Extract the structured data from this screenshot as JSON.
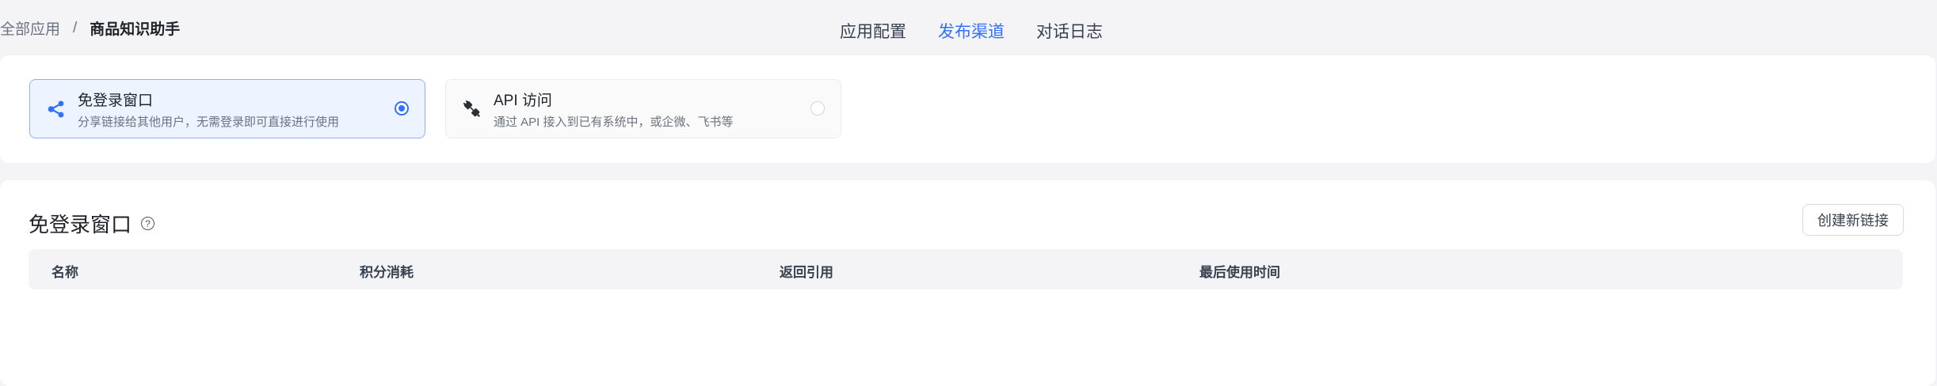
{
  "breadcrumb": {
    "root": "全部应用",
    "separator": "/",
    "current": "商品知识助手"
  },
  "tabs": [
    {
      "label": "应用配置",
      "active": false
    },
    {
      "label": "发布渠道",
      "active": true
    },
    {
      "label": "对话日志",
      "active": false
    }
  ],
  "channels": [
    {
      "title": "免登录窗口",
      "desc": "分享链接给其他用户，无需登录即可直接进行使用",
      "icon": "share-icon",
      "selected": true
    },
    {
      "title": "API 访问",
      "desc": "通过 API 接入到已有系统中，或企微、飞书等",
      "icon": "api-plug-icon",
      "selected": false
    }
  ],
  "section": {
    "title": "免登录窗口",
    "help_icon": "question-circle-icon",
    "help_glyph": "?",
    "create_label": "创建新链接",
    "columns": [
      "名称",
      "积分消耗",
      "返回引用",
      "最后使用时间"
    ]
  },
  "colors": {
    "accent": "#3370ff",
    "background": "#f4f4f6",
    "card": "#ffffff"
  }
}
